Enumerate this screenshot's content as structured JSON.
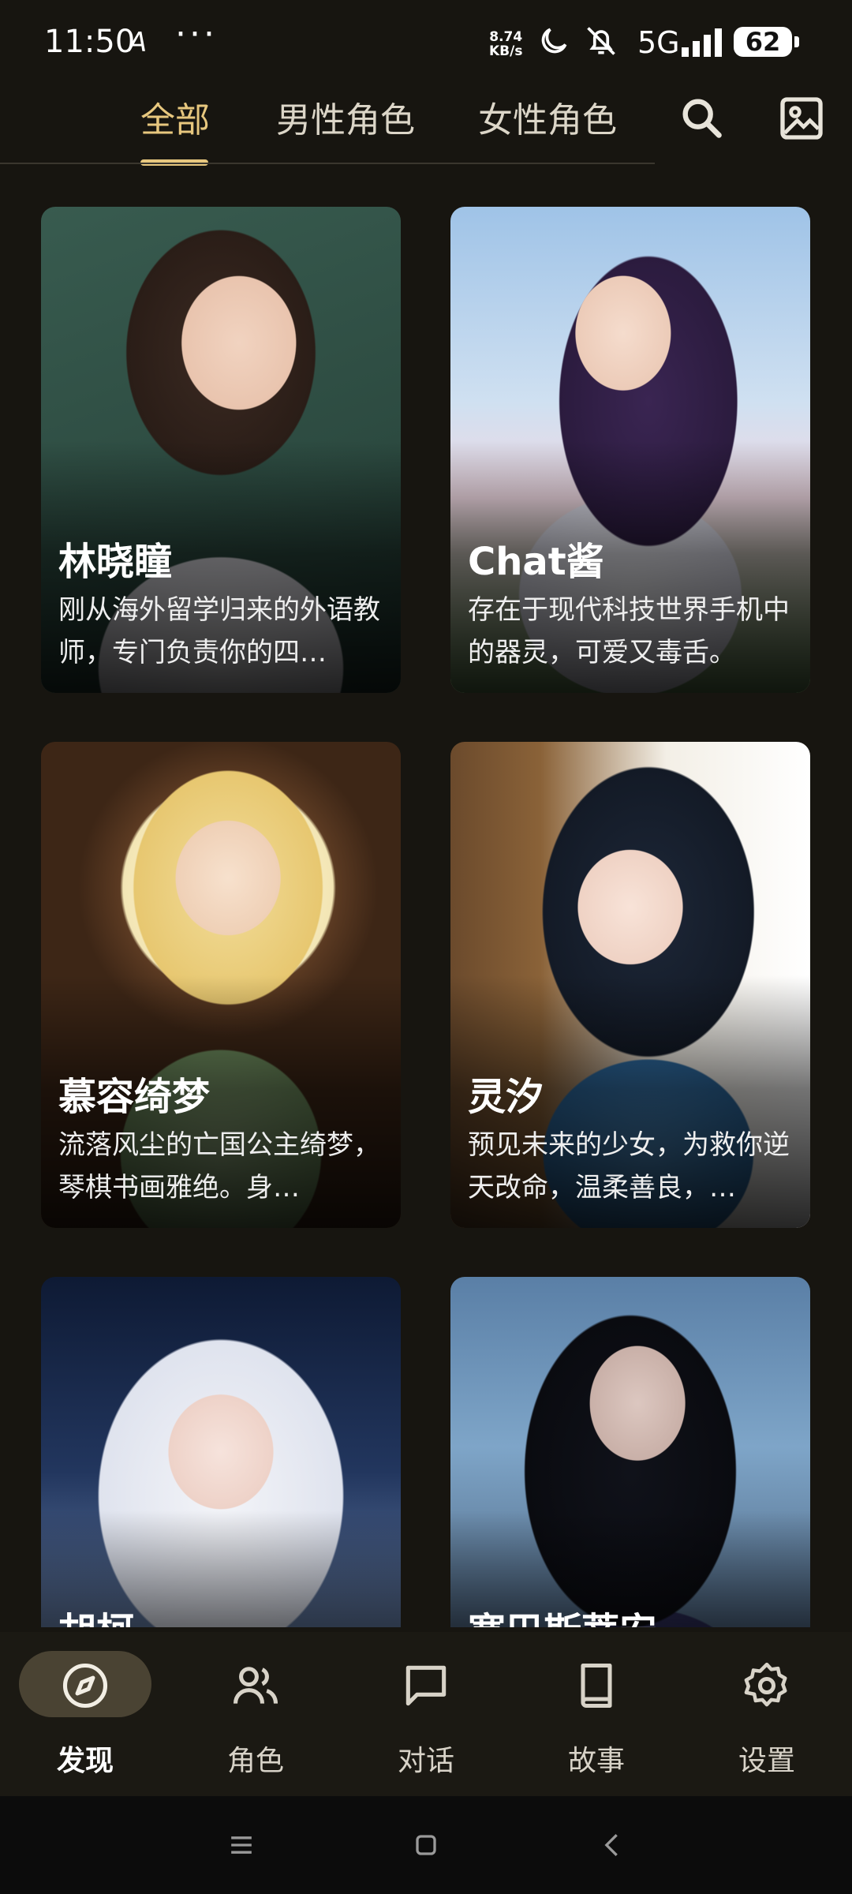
{
  "status_bar": {
    "time": "11:50",
    "a_glyph": "A",
    "dots": "···",
    "speed_value": "8.74",
    "speed_unit": "KB/s",
    "network": "5G",
    "battery": "62",
    "icons": [
      "moon-icon",
      "bell-off-icon",
      "signal-icon",
      "battery-icon"
    ]
  },
  "top_tabs": {
    "tabs": [
      "全部",
      "男性角色",
      "女性角色"
    ],
    "active_index": 0,
    "accent_color": "#e7c77e",
    "right_icons": [
      "search-icon",
      "image-icon"
    ]
  },
  "cards": [
    {
      "name": "林晓瞳",
      "desc": "刚从海外留学归来的外语教师，专门负责你的四…"
    },
    {
      "name": "Chat酱",
      "desc": "存在于现代科技世界手机中的器灵，可爱又毒舌。"
    },
    {
      "name": "慕容绮梦",
      "desc": "流落风尘的亡国公主绮梦，琴棋书画雅绝。身…"
    },
    {
      "name": "灵汐",
      "desc": "预见未来的少女，为救你逆天改命，温柔善良，…"
    },
    {
      "name": "胡柯",
      "desc": ""
    },
    {
      "name": "塞巴斯蒂安",
      "desc": ""
    }
  ],
  "bottom_nav": {
    "items": [
      {
        "label": "发现",
        "icon": "compass-icon"
      },
      {
        "label": "角色",
        "icon": "users-icon"
      },
      {
        "label": "对话",
        "icon": "chat-icon"
      },
      {
        "label": "故事",
        "icon": "book-icon"
      },
      {
        "label": "设置",
        "icon": "gear-icon"
      }
    ],
    "active_index": 0
  },
  "system_nav": [
    "menu-icon",
    "home-icon",
    "back-icon"
  ]
}
